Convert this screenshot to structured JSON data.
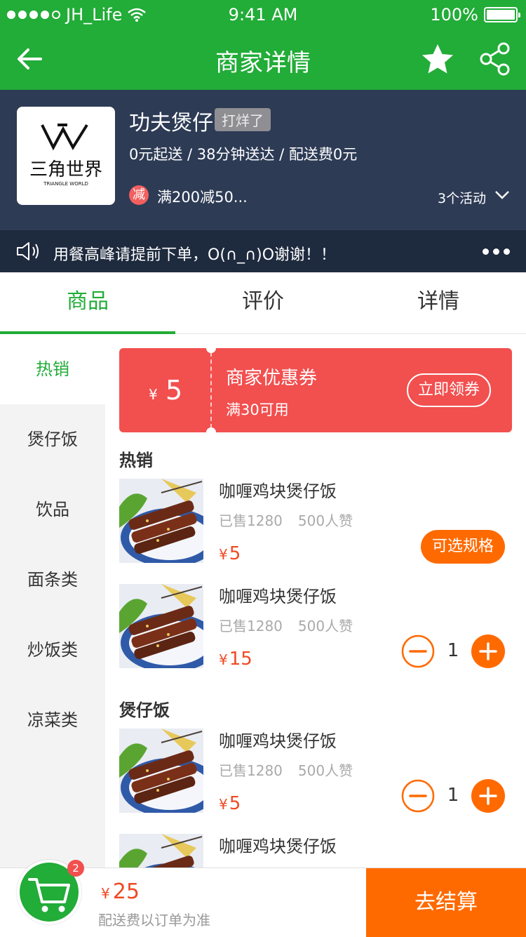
{
  "status_bar": {
    "carrier": "JH_Life",
    "time": "9:41 AM",
    "battery": "100%"
  },
  "nav": {
    "title": "商家详情",
    "back_icon": "arrow-left-icon",
    "fav_icon": "star-icon",
    "share_icon": "share-icon"
  },
  "shop": {
    "logo_text": "三角世界",
    "logo_sub": "TRIANGLE WORLD",
    "name": "功夫煲仔",
    "status_tag": "打烊了",
    "info": "0元起送 / 38分钟送达 / 配送费0元",
    "promo_icon": "减",
    "promo_text": "满200减50...",
    "activity_count": "3个活动"
  },
  "notice": {
    "text": "用餐高峰请提前下单，O(∩_∩)O谢谢！！"
  },
  "tabs": [
    {
      "label": "商品"
    },
    {
      "label": "评价"
    },
    {
      "label": "详情"
    }
  ],
  "categories": [
    {
      "label": "热销"
    },
    {
      "label": "煲仔饭"
    },
    {
      "label": "饮品"
    },
    {
      "label": "面条类"
    },
    {
      "label": "炒饭类"
    },
    {
      "label": "凉菜类"
    }
  ],
  "coupon": {
    "currency": "¥",
    "amount": "5",
    "title": "商家优惠券",
    "condition": "满30可用",
    "button": "立即领券"
  },
  "sections": [
    {
      "title": "热销"
    },
    {
      "title": "煲仔饭"
    }
  ],
  "products": [
    {
      "name": "咖喱鸡块煲仔饭",
      "sold": "已售1280",
      "likes": "500人赞",
      "currency": "¥",
      "price": "5",
      "action": "可选规格"
    },
    {
      "name": "咖喱鸡块煲仔饭",
      "sold": "已售1280",
      "likes": "500人赞",
      "currency": "¥",
      "price": "15",
      "qty": "1"
    },
    {
      "name": "咖喱鸡块煲仔饭",
      "sold": "已售1280",
      "likes": "500人赞",
      "currency": "¥",
      "price": "5",
      "qty": "1"
    },
    {
      "name": "咖喱鸡块煲仔饭"
    }
  ],
  "cart": {
    "badge": "2",
    "currency": "¥",
    "total": "25",
    "note": "配送费以订单为准",
    "checkout": "去结算"
  },
  "colors": {
    "green": "#22ac38",
    "navy": "#2d3b55",
    "orange": "#ff6a00",
    "red": "#f24f4f"
  }
}
